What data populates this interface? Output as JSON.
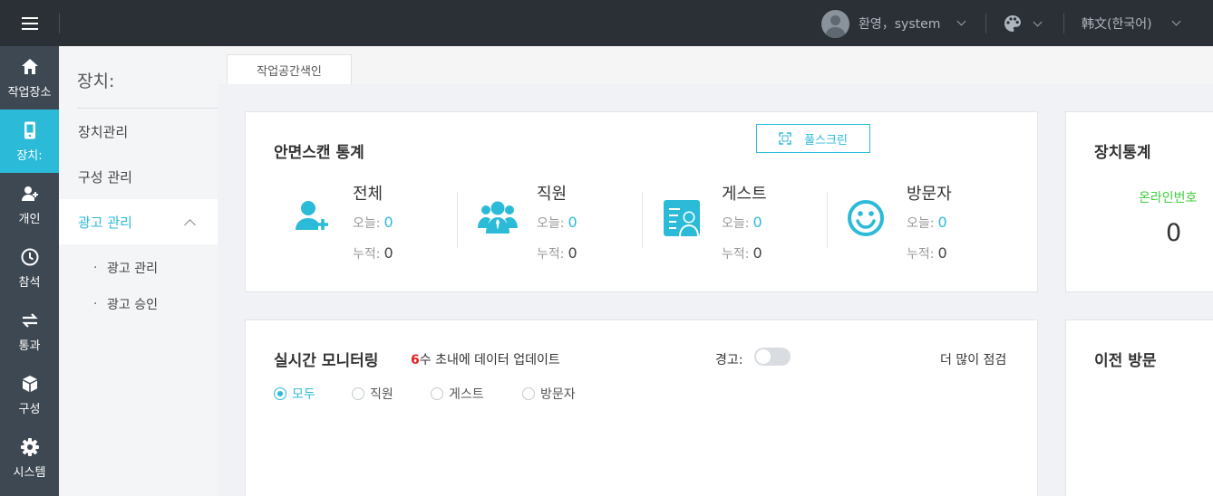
{
  "colors": {
    "accent": "#2bbbd8",
    "topbar": "#2b3037",
    "sidebar": "#3e4852",
    "online": "#3fcf3f",
    "warn_number": "#e02020"
  },
  "header": {
    "user_label": "환영，system",
    "language_label": "韩文(한국어)"
  },
  "nav": {
    "items": [
      {
        "label": "작업장소",
        "icon": "home-icon"
      },
      {
        "label": "장치:",
        "icon": "device-icon",
        "active": true
      },
      {
        "label": "개인",
        "icon": "person-add-icon"
      },
      {
        "label": "참석",
        "icon": "clock-icon"
      },
      {
        "label": "통과",
        "icon": "transfer-icon"
      },
      {
        "label": "구성",
        "icon": "cube-icon"
      },
      {
        "label": "시스템",
        "icon": "gear-icon"
      }
    ]
  },
  "submenu": {
    "title": "장치:",
    "items": [
      "장치관리",
      "구성 관리",
      "광고 관리"
    ],
    "children": [
      "광고 관리",
      "광고 승인"
    ]
  },
  "tabs": {
    "workspace_index": "작업공간색인"
  },
  "stats_card": {
    "title": "안면스캔 통계",
    "fullscreen_label": "풀스크린",
    "today_label": "오늘:",
    "total_label": "누적:",
    "items": [
      {
        "name": "전체",
        "today": "0",
        "total": "0",
        "icon": "person-add-icon"
      },
      {
        "name": "직원",
        "today": "0",
        "total": "0",
        "icon": "group-icon"
      },
      {
        "name": "게스트",
        "today": "0",
        "total": "0",
        "icon": "guest-card-icon"
      },
      {
        "name": "방문자",
        "today": "0",
        "total": "0",
        "icon": "smiley-icon"
      }
    ]
  },
  "device_stats": {
    "title": "장치통계",
    "online_label": "온라인번호",
    "online_value": "0"
  },
  "realtime": {
    "title": "실시간 모니터링",
    "update_number": "6",
    "update_text": "수 초내에 데이터 업데이트",
    "warning_label": "경고:",
    "more_label": "더 많이 점검",
    "filters": [
      "모두",
      "직원",
      "게스트",
      "방문자"
    ],
    "selected_filter": "모두"
  },
  "history": {
    "title": "이전 방문"
  }
}
